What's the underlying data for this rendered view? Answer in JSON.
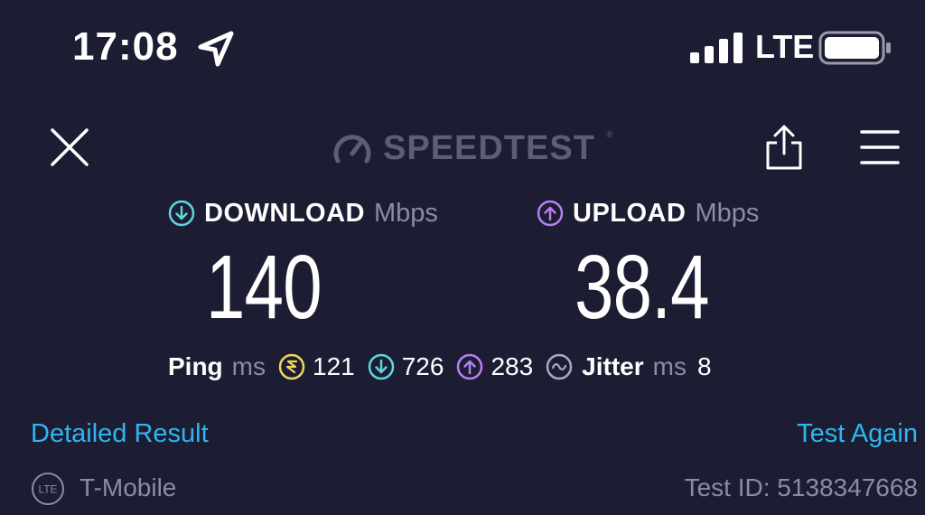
{
  "status_bar": {
    "time": "17:08",
    "network": "LTE",
    "icons": [
      "location-arrow-icon",
      "signal-bars-icon",
      "battery-icon"
    ]
  },
  "header": {
    "brand": "SPEEDTEST",
    "trademark": "®",
    "icons": [
      "close-icon",
      "speedometer-icon",
      "share-icon",
      "menu-icon"
    ]
  },
  "download": {
    "label": "DOWNLOAD",
    "unit": "Mbps",
    "value": "140",
    "icon": "arrow-down-circle-icon"
  },
  "upload": {
    "label": "UPLOAD",
    "unit": "Mbps",
    "value": "38.4",
    "icon": "arrow-up-circle-icon"
  },
  "stats": {
    "ping_label": "Ping",
    "ping_unit": "ms",
    "idle_ping": "121",
    "download_ping": "726",
    "upload_ping": "283",
    "jitter_label": "Jitter",
    "jitter_unit": "ms",
    "jitter": "8"
  },
  "links": {
    "detailed": "Detailed Result",
    "test_again": "Test Again"
  },
  "footer": {
    "lte_badge": "LTE",
    "carrier": "T-Mobile",
    "test_id": "Test ID: 5138347668"
  },
  "colors": {
    "background": "#1c1d33",
    "download_accent": "#5fd5e0",
    "upload_accent": "#b77ef4",
    "ping_accent": "#f0d55c",
    "link": "#2fb6f0",
    "muted": "#8b8ca4"
  }
}
